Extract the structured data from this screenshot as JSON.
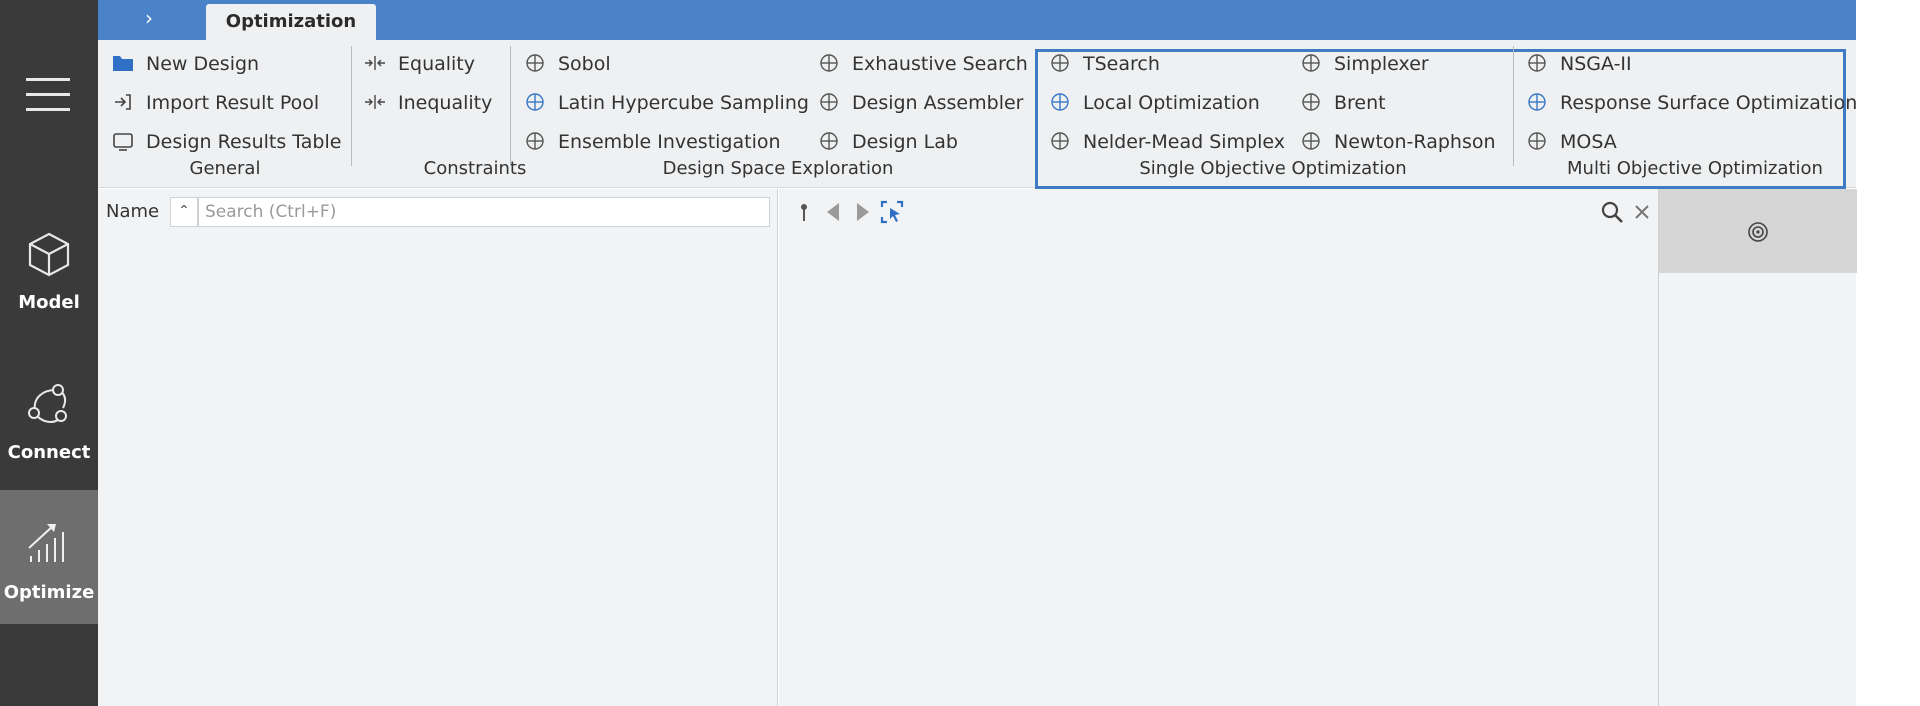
{
  "rail": {
    "items": [
      {
        "label": "Model",
        "icon": "cube-icon"
      },
      {
        "label": "Connect",
        "icon": "connect-icon"
      },
      {
        "label": "Optimize",
        "icon": "optimize-chart-icon",
        "active": true
      }
    ]
  },
  "topbar": {
    "expand_icon": "chevron-right-icon",
    "tab_label": "Optimization"
  },
  "ribbon": {
    "general": {
      "label": "General",
      "items": [
        "New Design",
        "Import Result Pool",
        "Design Results Table"
      ]
    },
    "constraints": {
      "label": "Constraints",
      "items": [
        "Equality",
        "Inequality"
      ]
    },
    "design_space": {
      "label": "Design Space Exploration",
      "items": [
        "Sobol",
        "Latin Hypercube Sampling",
        "Ensemble Investigation",
        "Exhaustive Search",
        "Design Assembler",
        "Design Lab"
      ]
    },
    "single_objective": {
      "label": "Single Objective Optimization",
      "items": [
        "TSearch",
        "Local Optimization",
        "Nelder-Mead Simplex",
        "Simplexer",
        "Brent",
        "Newton-Raphson"
      ]
    },
    "multi_objective": {
      "label": "Multi Objective Optimization",
      "items": [
        "NSGA-II",
        "Response Surface Optimization",
        "MOSA"
      ]
    }
  },
  "left_panel": {
    "name_label": "Name",
    "search_placeholder": "Search (Ctrl+F)"
  },
  "colors": {
    "topbar": "#4a82c8",
    "rail": "#3a3a3a",
    "rail_active": "#6e6e6e",
    "highlight": "#3f7ac4"
  }
}
